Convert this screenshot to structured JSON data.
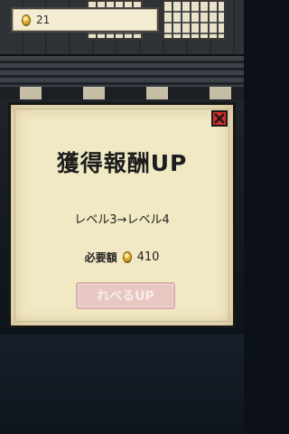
{
  "coins": {
    "value": "21"
  },
  "modal": {
    "title": "獲得報酬UP",
    "level_change": "レベル3→レベル4",
    "cost_label": "必要額",
    "cost_value": "410",
    "upgrade_button": "れべるUP",
    "upgrade_button_state": "disabled"
  },
  "icons": {
    "coin": "coin-icon",
    "close": "close-icon"
  },
  "colors": {
    "modal_bg": "#f1e8c4",
    "close_button": "#d42b2b",
    "upgrade_disabled": "#e8c6c2"
  }
}
